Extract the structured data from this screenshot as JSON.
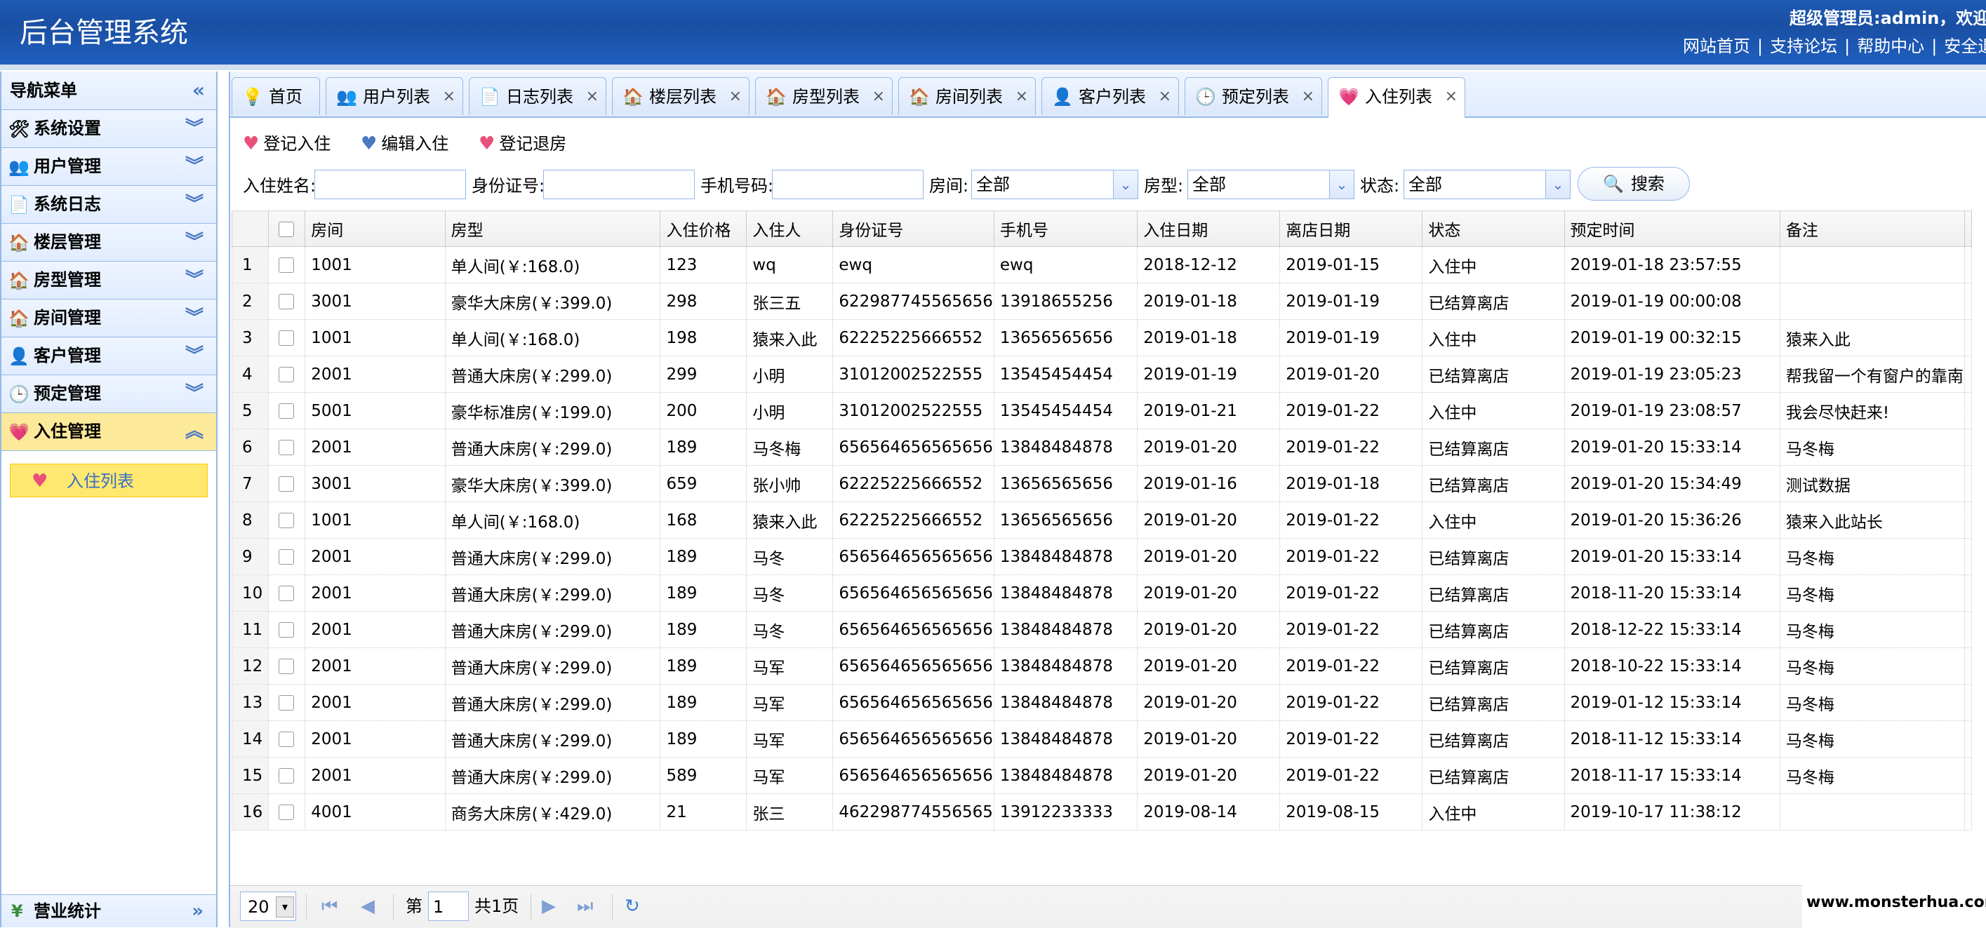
{
  "header": {
    "title": "后台管理系统",
    "user": "超级管理员:admin，欢迎您",
    "links": [
      "网站首页",
      "支持论坛",
      "帮助中心",
      "安全退出"
    ]
  },
  "sidebar": {
    "title": "导航菜单",
    "collapse_icon": "«",
    "items": [
      {
        "label": "系统设置",
        "icon": "🛠"
      },
      {
        "label": "用户管理",
        "icon": "👥"
      },
      {
        "label": "系统日志",
        "icon": "📄"
      },
      {
        "label": "楼层管理",
        "icon": "🏠"
      },
      {
        "label": "房型管理",
        "icon": "🏠"
      },
      {
        "label": "房间管理",
        "icon": "🏠"
      },
      {
        "label": "客户管理",
        "icon": "👤"
      },
      {
        "label": "预定管理",
        "icon": "🕒"
      },
      {
        "label": "入住管理",
        "icon": "💗"
      }
    ],
    "sub_item": "入住列表",
    "bottom_item": "营业统计",
    "bottom_icon": "¥"
  },
  "tabs": [
    {
      "label": "首页",
      "icon": "💡"
    },
    {
      "label": "用户列表",
      "icon": "👥"
    },
    {
      "label": "日志列表",
      "icon": "📄"
    },
    {
      "label": "楼层列表",
      "icon": "🏠"
    },
    {
      "label": "房型列表",
      "icon": "🏠"
    },
    {
      "label": "房间列表",
      "icon": "🏠"
    },
    {
      "label": "客户列表",
      "icon": "👤"
    },
    {
      "label": "预定列表",
      "icon": "🕒"
    },
    {
      "label": "入住列表",
      "icon": "💗"
    }
  ],
  "toolbar": {
    "checkin": "登记入住",
    "edit": "编辑入住",
    "checkout": "登记退房"
  },
  "search": {
    "name_label": "入住姓名:",
    "id_label": "身份证号:",
    "phone_label": "手机号码:",
    "room_label": "房间:",
    "room_value": "全部",
    "type_label": "房型:",
    "type_value": "全部",
    "status_label": "状态:",
    "status_value": "全部",
    "button": "搜索"
  },
  "table": {
    "columns": [
      "房间",
      "房型",
      "入住价格",
      "入住人",
      "身份证号",
      "手机号",
      "入住日期",
      "离店日期",
      "状态",
      "预定时间",
      "备注"
    ],
    "rows": [
      [
        "1",
        "1001",
        "单人间(￥:168.0)",
        "123",
        "wq",
        "ewq",
        "ewq",
        "2018-12-12",
        "2019-01-15",
        "入住中",
        "2019-01-18 23:57:55",
        ""
      ],
      [
        "2",
        "3001",
        "豪华大床房(￥:399.0)",
        "298",
        "张三五",
        "622987745565656",
        "13918655256",
        "2019-01-18",
        "2019-01-19",
        "已结算离店",
        "2019-01-19 00:00:08",
        ""
      ],
      [
        "3",
        "1001",
        "单人间(￥:168.0)",
        "198",
        "猿来入此",
        "62225225666552",
        "13656565656",
        "2019-01-18",
        "2019-01-19",
        "入住中",
        "2019-01-19 00:32:15",
        "猿来入此"
      ],
      [
        "4",
        "2001",
        "普通大床房(￥:299.0)",
        "299",
        "小明",
        "31012002522555",
        "13545454454",
        "2019-01-19",
        "2019-01-20",
        "已结算离店",
        "2019-01-19 23:05:23",
        "帮我留一个有窗户的靠南"
      ],
      [
        "5",
        "5001",
        "豪华标准房(￥:199.0)",
        "200",
        "小明",
        "31012002522555",
        "13545454454",
        "2019-01-21",
        "2019-01-22",
        "入住中",
        "2019-01-19 23:08:57",
        "我会尽快赶来!"
      ],
      [
        "6",
        "2001",
        "普通大床房(￥:299.0)",
        "189",
        "马冬梅",
        "656564656565656",
        "13848484878",
        "2019-01-20",
        "2019-01-22",
        "已结算离店",
        "2019-01-20 15:33:14",
        "马冬梅"
      ],
      [
        "7",
        "3001",
        "豪华大床房(￥:399.0)",
        "659",
        "张小帅",
        "62225225666552",
        "13656565656",
        "2019-01-16",
        "2019-01-18",
        "已结算离店",
        "2019-01-20 15:34:49",
        "测试数据"
      ],
      [
        "8",
        "1001",
        "单人间(￥:168.0)",
        "168",
        "猿来入此",
        "62225225666552",
        "13656565656",
        "2019-01-20",
        "2019-01-22",
        "入住中",
        "2019-01-20 15:36:26",
        "猿来入此站长"
      ],
      [
        "9",
        "2001",
        "普通大床房(￥:299.0)",
        "189",
        "马冬",
        "656564656565656",
        "13848484878",
        "2019-01-20",
        "2019-01-22",
        "已结算离店",
        "2019-01-20 15:33:14",
        "马冬梅"
      ],
      [
        "10",
        "2001",
        "普通大床房(￥:299.0)",
        "189",
        "马冬",
        "656564656565656",
        "13848484878",
        "2019-01-20",
        "2019-01-22",
        "已结算离店",
        "2018-11-20 15:33:14",
        "马冬梅"
      ],
      [
        "11",
        "2001",
        "普通大床房(￥:299.0)",
        "189",
        "马冬",
        "656564656565656",
        "13848484878",
        "2019-01-20",
        "2019-01-22",
        "已结算离店",
        "2018-12-22 15:33:14",
        "马冬梅"
      ],
      [
        "12",
        "2001",
        "普通大床房(￥:299.0)",
        "189",
        "马军",
        "656564656565656",
        "13848484878",
        "2019-01-20",
        "2019-01-22",
        "已结算离店",
        "2018-10-22 15:33:14",
        "马冬梅"
      ],
      [
        "13",
        "2001",
        "普通大床房(￥:299.0)",
        "189",
        "马军",
        "656564656565656",
        "13848484878",
        "2019-01-20",
        "2019-01-22",
        "已结算离店",
        "2019-01-12 15:33:14",
        "马冬梅"
      ],
      [
        "14",
        "2001",
        "普通大床房(￥:299.0)",
        "189",
        "马军",
        "656564656565656",
        "13848484878",
        "2019-01-20",
        "2019-01-22",
        "已结算离店",
        "2018-11-12 15:33:14",
        "马冬梅"
      ],
      [
        "15",
        "2001",
        "普通大床房(￥:299.0)",
        "589",
        "马军",
        "656564656565656",
        "13848484878",
        "2019-01-20",
        "2019-01-22",
        "已结算离店",
        "2018-11-17 15:33:14",
        "马冬梅"
      ],
      [
        "16",
        "4001",
        "商务大床房(￥:429.0)",
        "21",
        "张三",
        "462298774556565",
        "13912233333",
        "2019-08-14",
        "2019-08-15",
        "入住中",
        "2019-10-17 11:38:12",
        ""
      ]
    ]
  },
  "pager": {
    "page_size": "20",
    "page_prefix": "第",
    "page_value": "1",
    "total": "共1页"
  },
  "watermark": "www.monsterhua.com"
}
